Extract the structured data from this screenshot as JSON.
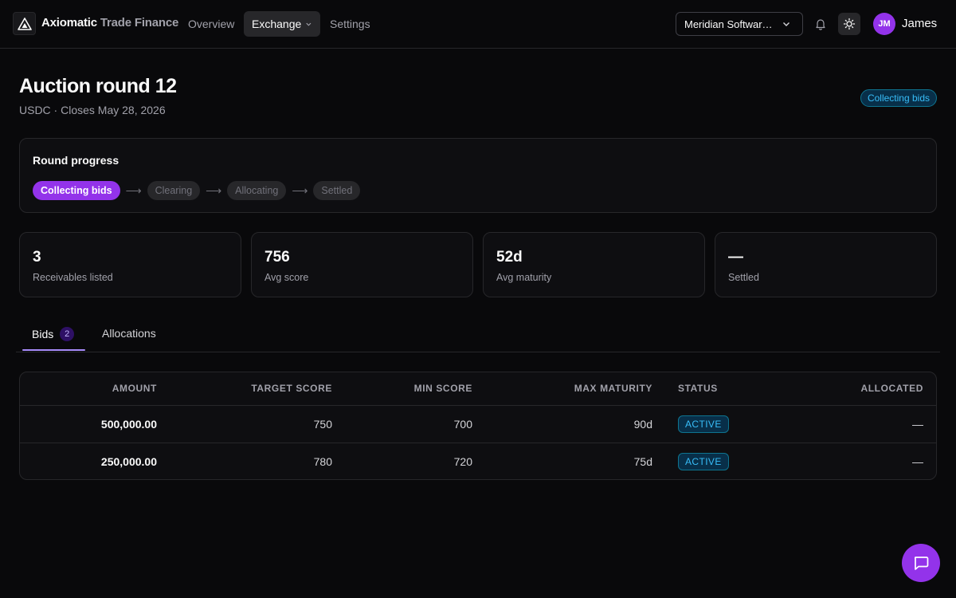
{
  "app": {
    "brand": "Axiomatic",
    "brand_sub": "Trade Finance"
  },
  "nav": [
    {
      "label": "Overview"
    },
    {
      "label": "Exchange"
    },
    {
      "label": "Settings"
    }
  ],
  "org_selector": {
    "value": "Meridian Software Inc."
  },
  "user": {
    "initials": "JM",
    "name": "James"
  },
  "page": {
    "title": "Auction round 12",
    "subtitle": "USDC · Closes May 28, 2026",
    "status_badge": "Collecting bids"
  },
  "progress": {
    "title": "Round progress",
    "steps": [
      "Collecting bids",
      "Clearing",
      "Allocating",
      "Settled"
    ],
    "current_step": 0
  },
  "stats": [
    {
      "value": "3",
      "label": "Receivables listed"
    },
    {
      "value": "756",
      "label": "Avg score"
    },
    {
      "value": "52d",
      "label": "Avg maturity"
    },
    {
      "value": "—",
      "label": "Settled"
    }
  ],
  "tabs": [
    {
      "label": "Bids",
      "count": "2"
    },
    {
      "label": "Allocations"
    }
  ],
  "table": {
    "columns": [
      "AMOUNT",
      "TARGET SCORE",
      "MIN SCORE",
      "MAX MATURITY",
      "STATUS",
      "ALLOCATED"
    ],
    "rows": [
      [
        "500,000.00",
        "750",
        "700",
        "90d",
        "ACTIVE",
        "—"
      ],
      [
        "250,000.00",
        "780",
        "720",
        "75d",
        "ACTIVE",
        "—"
      ]
    ]
  },
  "colors": {
    "accent": "#9333ea",
    "status": "#38bdf8",
    "background": "#09090b"
  }
}
